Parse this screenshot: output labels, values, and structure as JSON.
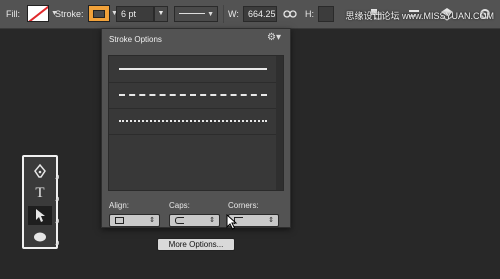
{
  "options_bar": {
    "fill_label": "Fill:",
    "stroke_label": "Stroke:",
    "stroke_width": "6 pt",
    "w_label": "W:",
    "w_value": "664.25",
    "h_label": "H:",
    "watermark": "思缘设计论坛 www.MISSYUAN.COM"
  },
  "stroke_panel": {
    "title": "Stroke Options",
    "line_styles": [
      "solid",
      "dashed",
      "dotted"
    ],
    "align_label": "Align:",
    "caps_label": "Caps:",
    "corners_label": "Corners:",
    "more_options_label": "More Options..."
  },
  "toolbox": {
    "tools": [
      "pen-tool",
      "type-tool",
      "path-selection-tool",
      "ellipse-tool"
    ],
    "active_tool": "path-selection-tool"
  },
  "colors": {
    "fill_slash": "#e0292b",
    "stroke_color": "#f2a23a",
    "canvas_bg": "#282828"
  }
}
